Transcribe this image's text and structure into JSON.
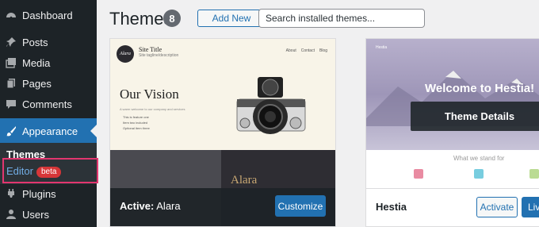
{
  "sidebar": {
    "items": [
      {
        "label": "Dashboard",
        "icon": "dashboard-icon"
      },
      {
        "label": "Posts",
        "icon": "pin-icon"
      },
      {
        "label": "Media",
        "icon": "media-icon"
      },
      {
        "label": "Pages",
        "icon": "pages-icon"
      },
      {
        "label": "Comments",
        "icon": "comments-icon"
      },
      {
        "label": "Appearance",
        "icon": "paintbrush-icon"
      },
      {
        "label": "Plugins",
        "icon": "plugin-icon"
      },
      {
        "label": "Users",
        "icon": "users-icon"
      }
    ],
    "submenu": {
      "themes": "Themes",
      "editor": "Editor",
      "editor_badge": "beta"
    },
    "highlight_color": "#e2366f"
  },
  "header": {
    "title": "Themes",
    "count": "8",
    "add_new": "Add New",
    "search_placeholder": "Search installed themes..."
  },
  "themes": {
    "active": {
      "prefix": "Active:",
      "name": "Alara",
      "customize": "Customize",
      "preview": {
        "logo": "Alara",
        "site_title": "Site Title",
        "tagline": "Site tagline/description",
        "nav": [
          "About",
          "Contact",
          "Blog"
        ],
        "headline": "Our Vision",
        "welcome": "A warm welcome to our company and services",
        "features": [
          "This is feature one",
          "Item two included",
          "Optional item three"
        ],
        "banner_word": "Alara"
      }
    },
    "second": {
      "name": "Hestia",
      "activate": "Activate",
      "live": "Live",
      "details": "Theme Details",
      "preview": {
        "brand": "Hestia",
        "welcome": "Welcome to Hestia!",
        "section": "What we stand for"
      }
    }
  },
  "colors": {
    "accent": "#2271b1",
    "sidebar_bg": "#1d2327",
    "badge": "#d63638"
  }
}
